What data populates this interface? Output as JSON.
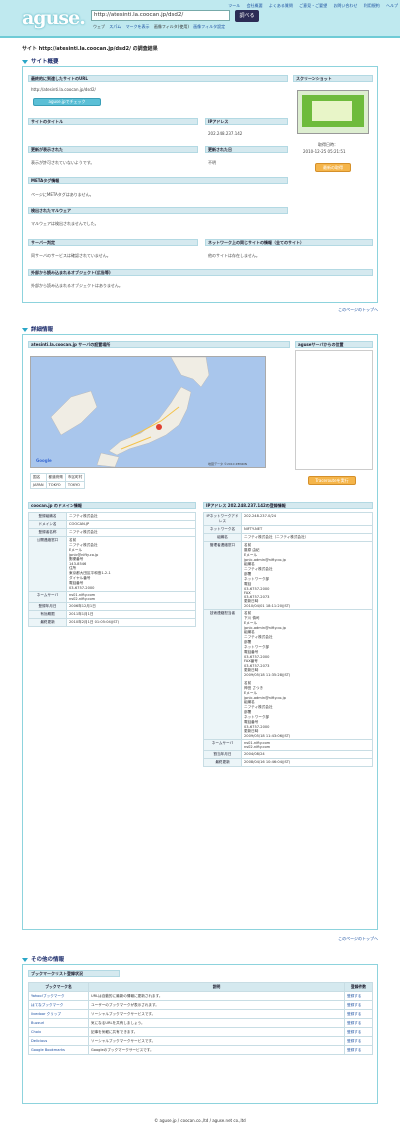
{
  "header": {
    "logo": "aguse.",
    "url_value": "http://atesinti.la.coocan.jp/dsd2/",
    "go_label": "調べる",
    "options": [
      "ウェブ",
      "スパム",
      "マークを表示",
      "画像フィルタ(使用)",
      "画像フィルタ設定"
    ],
    "top_nav": [
      "ツール",
      "会社概要",
      "よくある質問",
      "ご意見・ご要望",
      "お問い合わせ",
      "利用規約",
      "ヘルプ"
    ]
  },
  "page_title": "サイト http://atesinti.la.coocan.jp/dsd2/ の調査結果",
  "overview": {
    "heading": "サイト概要",
    "final_url_label": "最終的に到達したサイトのURL",
    "final_url": "http://atesinti.la.coocan.jp/dsd2/",
    "check_button": "aguse.jpでチェック",
    "screenshot_label": "スクリーンショット",
    "screenshot_date_label": "取得日時：",
    "screenshot_date": "2010-12-25 05:21:51",
    "reload_button": "最新の取得",
    "site_title_label": "サイトのタイトル",
    "ip_label": "IPアドレス",
    "ip_value": "202.248.237.142",
    "content_label": "更新が表示された",
    "content_text": "表示が許可されていないようです。",
    "updated_label": "更新された日",
    "updated_value": "不明",
    "meta_label": "METAタグ情報",
    "meta_text": "ページにMETAタグはありません。",
    "malware_label": "検出されたマルウェア",
    "malware_text": "マルウェアは検出されませんでした。",
    "blacklist_label": "サーバー判定",
    "blacklist_text": "同サーバのサービスは確認されていません。",
    "redirect_label": "ネットワーク上の同じサイトの情報（全てのサイト）",
    "redirect_text": "他のサイトは存在しません。",
    "object_label": "外部から読み込まれるオブジェクト(広告等)",
    "object_text": "外部から読み込まれるオブジェクトはありません。",
    "back_top": "このページのトップへ"
  },
  "detail": {
    "heading": "詳細情報",
    "map_title": "atesinti.la.coocan.jp サーバの設置場所",
    "map_credit": "Google",
    "map_small": "地図データ ©2010 ZENRIN",
    "map_table_headers": [
      "国名",
      "都道府県",
      "市区町村"
    ],
    "map_table_row": [
      "JAPAN",
      "TOKYO",
      "TOKYO"
    ],
    "side_title": "aguseサーバからの位置",
    "side_button": "Tracerouteを実行",
    "domain_title": "coocan.jp のドメイン情報",
    "domain_rows": [
      {
        "k": "登録組織名",
        "v": "ニフティ株式会社"
      },
      {
        "k": "ドメイン名",
        "v": "COOCAN.JP"
      },
      {
        "k": "登録者名称",
        "v": "ニフティ株式会社"
      },
      {
        "k": "公開連絡窓口",
        "v": "名前\nニフティ株式会社\nEメール\njpnic@nifty.co.jp\n郵便番号\n143-8546\n住所\n東京都大田区平和島1-2-1\nダイヤル番号\n電話番号\n03-6757-2000"
      },
      {
        "k": "ネームサーバ",
        "v": "ns01.nifty.com\nns02.nifty.com"
      },
      {
        "k": "登録年月日",
        "v": "2006年12月1日"
      },
      {
        "k": "有効期限",
        "v": "2011年1月1日"
      },
      {
        "k": "最終更新",
        "v": "2010年2月1日 01:05:04(JST)"
      }
    ],
    "ip_title": "IPアドレス 202.248.237.142の登録情報",
    "ip_rows": [
      {
        "k": "IPネットワークアドレス",
        "v": "202.248.237.0/24"
      },
      {
        "k": "ネットワーク名",
        "v": "NIFTY-NET"
      },
      {
        "k": "組織名",
        "v": "ニフティ株式会社（ニフティ株式会社）"
      },
      {
        "k": "管理者連絡窓口",
        "v": "名前\n藤原 由紀\nEメール\njpnic-admin@nifty.co.jp\n組織名\nニフティ株式会社\n部署\nネットワーク部\n電話\n03-6757-2000\nFAX\n03-6757-2073\n更新日時\n2010/04/01 18:11:20(JST)"
      },
      {
        "k": "技術連絡担当者",
        "v": "名前\n下川 慎司\nEメール\njpnic-admin@nifty.co.jp\n組織名\nニフティ株式会社\n部署\nネットワーク部\n電話番号\n03-6757-2000\nFAX番号\n03-6757-2073\n更新日時\n2009/05/18 11:35:28(JST)\n\n名前\n神田 さつき\nEメール\njpnic-admin@nifty.co.jp\n組織名\nニフティ株式会社\n部署\nネットワーク部\n電話番号\n03-6757-2000\n更新日時\n2009/05/18 11:43:06(JST)"
      },
      {
        "k": "ネームサーバ",
        "v": "ns01.nifty.com\nns02.nifty.com"
      },
      {
        "k": "割当年月日",
        "v": "2004/08/24"
      },
      {
        "k": "最終更新",
        "v": "2008/04/16 10:46:04(JST)"
      }
    ],
    "back_top": "このページのトップへ"
  },
  "other": {
    "heading": "その他の情報",
    "box_title": "ブックマークリスト登録状況",
    "headers": [
      "ブックマーク名",
      "説明",
      "登録件数"
    ],
    "rows": [
      [
        "Yahoo!ブックマーク",
        "URLは自動的に最新の情報に更新されます。",
        "登録する"
      ],
      [
        "はてなブックマーク",
        "ユーザーのブックマークが表示されます。",
        "登録する"
      ],
      [
        "livedoor クリップ",
        "ソーシャルブックマークサービスです。",
        "登録する"
      ],
      [
        "Buzzurl",
        "気になるURLを共有しましょう。",
        "登録する"
      ],
      [
        "Choix",
        "記事を気軽に共有できます。",
        "登録する"
      ],
      [
        "Delicious",
        "ソーシャルブックマークサービスです。",
        "登録する"
      ],
      [
        "Google Bookmarks",
        "Googleのブックマークサービスです。",
        "登録する"
      ]
    ]
  },
  "footer": "© aguse.jp / coocan.co.,ltd / aguse.net co.,ltd"
}
